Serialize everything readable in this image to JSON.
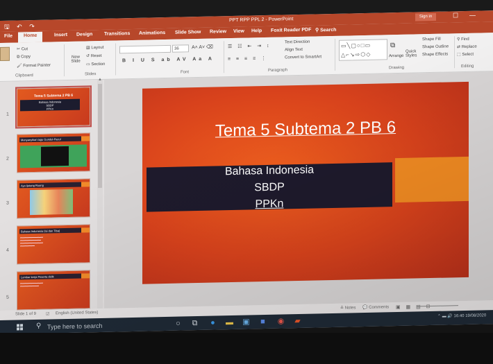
{
  "window": {
    "title": "PPT RPP PPL 2 - PowerPoint",
    "sign_in": "Sign in",
    "minimize": "—",
    "restore": "☐"
  },
  "tabs": [
    "File",
    "Home",
    "Insert",
    "Design",
    "Transitions",
    "Animations",
    "Slide Show",
    "Review",
    "View",
    "Help",
    "Foxit Reader PDF",
    "Search"
  ],
  "ribbon": {
    "clipboard": {
      "cut": "Cut",
      "copy": "Copy",
      "format_painter": "Format Painter",
      "label": "Clipboard"
    },
    "slides": {
      "new_slide": "New Slide",
      "layout": "Layout",
      "reset": "Reset",
      "section": "Section",
      "label": "Slides"
    },
    "font": {
      "size": "36",
      "label": "Font"
    },
    "paragraph": {
      "text_direction": "Text Direction",
      "align_text": "Align Text",
      "convert_smartart": "Convert to SmartArt",
      "label": "Paragraph"
    },
    "drawing": {
      "arrange": "Arrange",
      "quick_styles": "Quick Styles",
      "shape_fill": "Shape Fill",
      "shape_outline": "Shape Outline",
      "shape_effects": "Shape Effects",
      "label": "Drawing"
    },
    "editing": {
      "find": "Find",
      "replace": "Replace",
      "select": "Select",
      "label": "Editing"
    }
  },
  "thumbnails": [
    {
      "num": "1",
      "title": "Tema 5 Subtema 2 PB 6",
      "sub": [
        "Bahasa Indonesia",
        "SBDP",
        "PPKn"
      ]
    },
    {
      "num": "2",
      "title": "Menyanyikan lagu Gundul-Pacul"
    },
    {
      "num": "3",
      "title": "Ayo Ijutang Ruang"
    },
    {
      "num": "4",
      "title": "Bahasa Indonesia (Isi dan Tiba)"
    },
    {
      "num": "5",
      "title": "Lembar kerja Peserta didik"
    }
  ],
  "slide": {
    "title": "Tema 5 Subtema 2 PB 6",
    "line1": "Bahasa Indonesia",
    "line2": "SBDP",
    "line3": "PPKn"
  },
  "status": {
    "slide_info": "Slide 1 of 9",
    "language": "English (United States)",
    "notes": "Notes",
    "comments": "Comments"
  },
  "taskbar": {
    "search_placeholder": "Type here to search",
    "time": "16:40",
    "date": "19/08/2020"
  }
}
